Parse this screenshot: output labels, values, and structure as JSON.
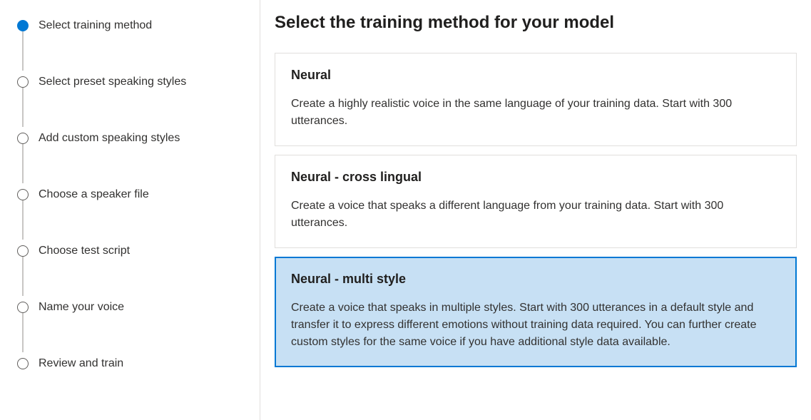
{
  "sidebar": {
    "steps": [
      {
        "label": "Select training method",
        "active": true
      },
      {
        "label": "Select preset speaking styles",
        "active": false
      },
      {
        "label": "Add custom speaking styles",
        "active": false
      },
      {
        "label": "Choose a speaker file",
        "active": false
      },
      {
        "label": "Choose test script",
        "active": false
      },
      {
        "label": "Name your voice",
        "active": false
      },
      {
        "label": "Review and train",
        "active": false
      }
    ]
  },
  "main": {
    "title": "Select the training method for your model",
    "options": [
      {
        "title": "Neural",
        "description": "Create a highly realistic voice in the same language of your training data. Start with 300 utterances.",
        "selected": false
      },
      {
        "title": "Neural - cross lingual",
        "description": "Create a voice that speaks a different language from your training data. Start with 300 utterances.",
        "selected": false
      },
      {
        "title": "Neural - multi style",
        "description": "Create a voice that speaks in multiple styles. Start with 300 utterances in a default style and transfer it to express different emotions without training data required. You can further create custom styles for the same voice if you have additional style data available.",
        "selected": true
      }
    ]
  }
}
